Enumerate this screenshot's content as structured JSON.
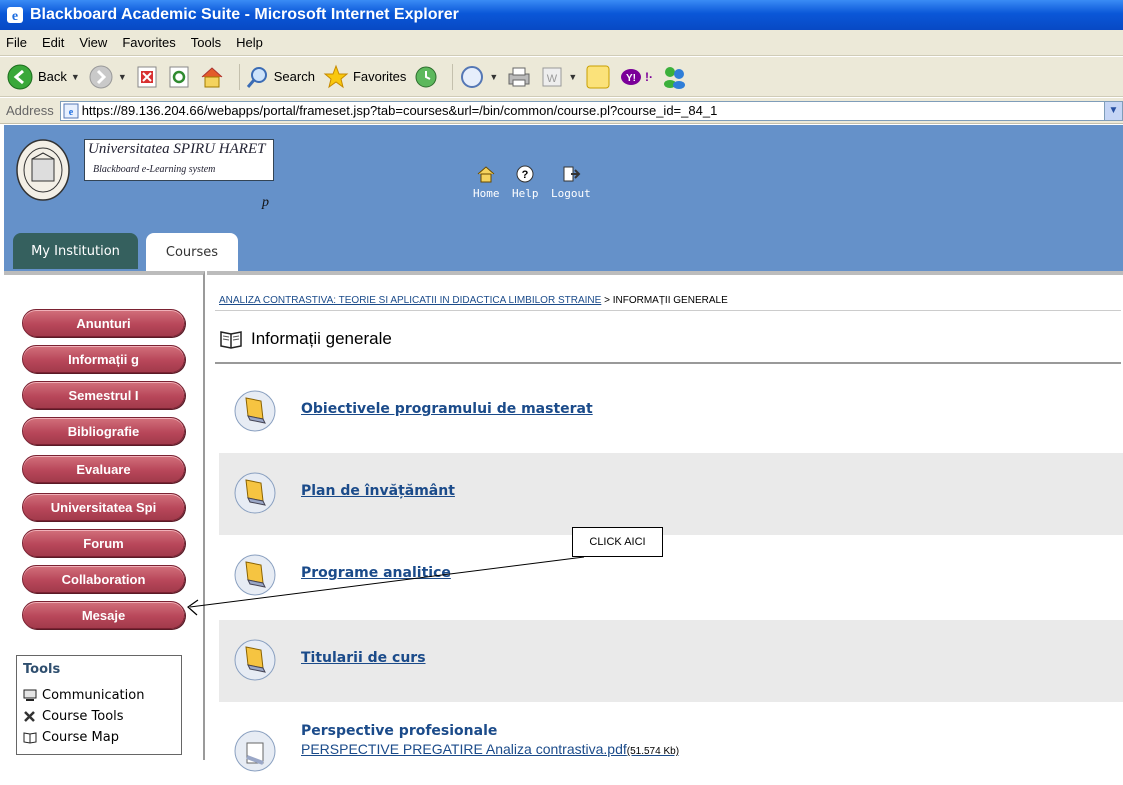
{
  "window": {
    "title": "Blackboard Academic Suite - Microsoft Internet Explorer"
  },
  "menu": {
    "items": [
      "File",
      "Edit",
      "View",
      "Favorites",
      "Tools",
      "Help"
    ]
  },
  "toolbar": {
    "back_label": "Back",
    "search_label": "Search",
    "favorites_label": "Favorites"
  },
  "address": {
    "label": "Address",
    "url": "https://89.136.204.66/webapps/portal/frameset.jsp?tab=courses&url=/bin/common/course.pl?course_id=_84_1"
  },
  "header": {
    "university_name": "Universitatea SPIRU HARET",
    "system_name": "Blackboard e-Learning system",
    "letter": "p",
    "nav": {
      "home": "Home",
      "help": "Help",
      "logout": "Logout"
    },
    "tabs": {
      "my_institution": "My Institution",
      "courses": "Courses"
    }
  },
  "course_menu": {
    "buttons": [
      "Anunturi",
      "Informații g",
      "Semestrul I",
      "Bibliografie",
      "Evaluare",
      "Universitatea Spi",
      "Forum",
      "Collaboration",
      "Mesaje"
    ]
  },
  "tools": {
    "title": "Tools",
    "items": [
      "Communication",
      "Course Tools",
      "Course Map"
    ]
  },
  "content": {
    "breadcrumb_link": "ANALIZA CONTRASTIVA: TEORIE SI APLICATII IN DIDACTICA LIMBILOR STRAINE",
    "breadcrumb_sep": " > ",
    "breadcrumb_current": "INFORMAȚII GENERALE",
    "page_title": "Informații generale",
    "items": [
      {
        "title": "Obiectivele programului de masterat"
      },
      {
        "title": "Plan de învățământ"
      },
      {
        "title": "Programe analitice"
      },
      {
        "title": "Titularii de curs"
      },
      {
        "title": "Perspective profesionale",
        "attachment": "PERSPECTIVE PREGATIRE Analiza contrastiva.pdf",
        "attachment_size": "(51.574 Kb)"
      }
    ]
  },
  "annotation": {
    "callout_text": "CLICK AICI"
  }
}
